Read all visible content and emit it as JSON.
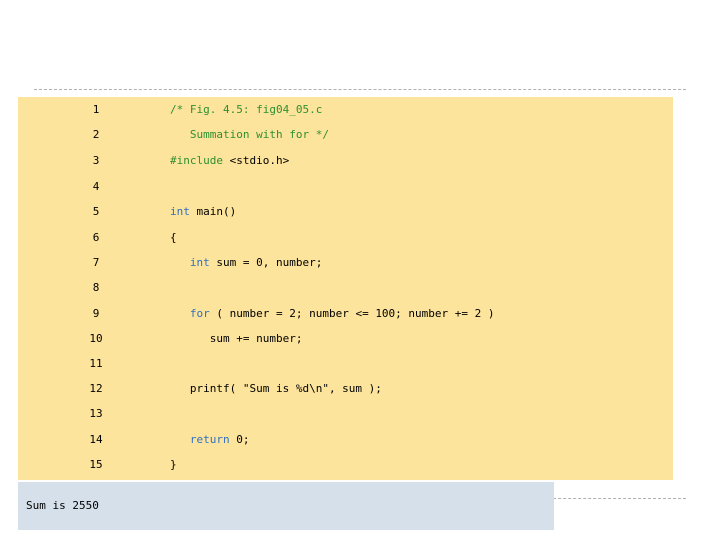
{
  "colors": {
    "code_background": "#fde49c",
    "output_background": "#d6e0ea",
    "comment": "#2f8f2f",
    "keyword": "#2f6fbf",
    "preprocessor": "#2f8f2f",
    "plain": "#000000"
  },
  "code": {
    "lines": [
      {
        "number": "1",
        "segments": [
          {
            "text": "/* Fig. 4.5: fig04_05.c",
            "kind": "comment"
          }
        ]
      },
      {
        "number": "2",
        "segments": [
          {
            "text": "   Summation with for */",
            "kind": "comment"
          }
        ]
      },
      {
        "number": "3",
        "segments": [
          {
            "text": "#include",
            "kind": "preprocessor"
          },
          {
            "text": " <stdio.h>",
            "kind": "plain"
          }
        ]
      },
      {
        "number": "4",
        "segments": []
      },
      {
        "number": "5",
        "segments": [
          {
            "text": "int",
            "kind": "keyword"
          },
          {
            "text": " main()",
            "kind": "plain"
          }
        ]
      },
      {
        "number": "6",
        "segments": [
          {
            "text": "{",
            "kind": "plain"
          }
        ]
      },
      {
        "number": "7",
        "segments": [
          {
            "text": "   ",
            "kind": "plain"
          },
          {
            "text": "int",
            "kind": "keyword"
          },
          {
            "text": " sum = 0, number;",
            "kind": "plain"
          }
        ]
      },
      {
        "number": "8",
        "segments": []
      },
      {
        "number": "9",
        "segments": [
          {
            "text": "   ",
            "kind": "plain"
          },
          {
            "text": "for",
            "kind": "keyword"
          },
          {
            "text": " ( number = 2; number <= 100; number += 2 )",
            "kind": "plain"
          }
        ]
      },
      {
        "number": "10",
        "segments": [
          {
            "text": "      sum += number;",
            "kind": "plain"
          }
        ]
      },
      {
        "number": "11",
        "segments": []
      },
      {
        "number": "12",
        "segments": [
          {
            "text": "   printf( \"Sum is %d\\n\", sum );",
            "kind": "plain"
          }
        ]
      },
      {
        "number": "13",
        "segments": []
      },
      {
        "number": "14",
        "segments": [
          {
            "text": "   ",
            "kind": "plain"
          },
          {
            "text": "return",
            "kind": "keyword"
          },
          {
            "text": " 0;",
            "kind": "plain"
          }
        ]
      },
      {
        "number": "15",
        "segments": [
          {
            "text": "}",
            "kind": "plain"
          }
        ]
      }
    ]
  },
  "output": {
    "text": "Sum is 2550"
  }
}
